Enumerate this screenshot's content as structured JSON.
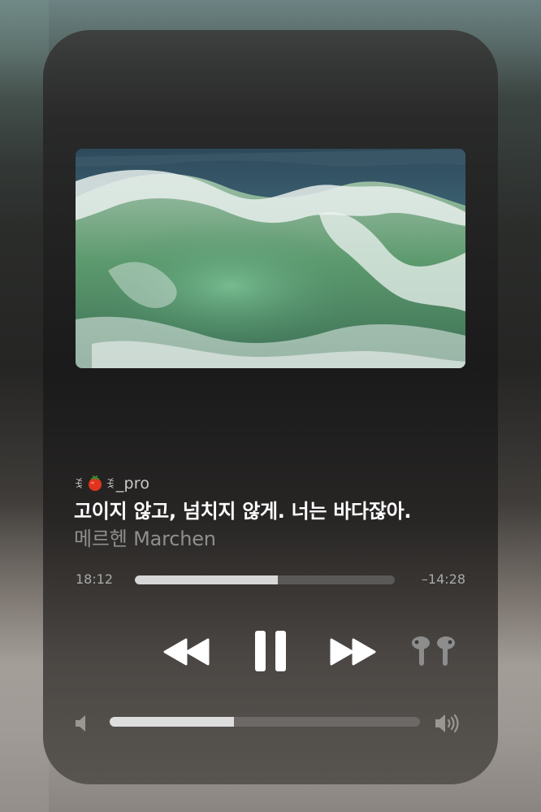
{
  "now_playing": {
    "source_name": "_pro",
    "source_prefix_icon": "emoji-glyph",
    "source_emoji_icon": "tomato-icon",
    "title": "고이지 않고, 넘치지 않게. 너는 바다잖아.",
    "artist": "메르헨 Marchen",
    "artwork_icon": "ocean-wave-artwork"
  },
  "playback": {
    "elapsed": "18:12",
    "remaining": "–14:28",
    "progress_fraction": 0.55,
    "state": "playing"
  },
  "controls": {
    "rewind_icon": "rewind-icon",
    "pause_icon": "pause-icon",
    "forward_icon": "fast-forward-icon",
    "output_icon": "airpods-pro-icon"
  },
  "volume": {
    "level_fraction": 0.4,
    "low_icon": "volume-low-icon",
    "high_icon": "volume-high-icon"
  },
  "colors": {
    "title_text": "#ffffff",
    "secondary_text": "#8f8f8f",
    "scrubber_fill": "#d7d7d7",
    "track": "#6e6e6e"
  }
}
